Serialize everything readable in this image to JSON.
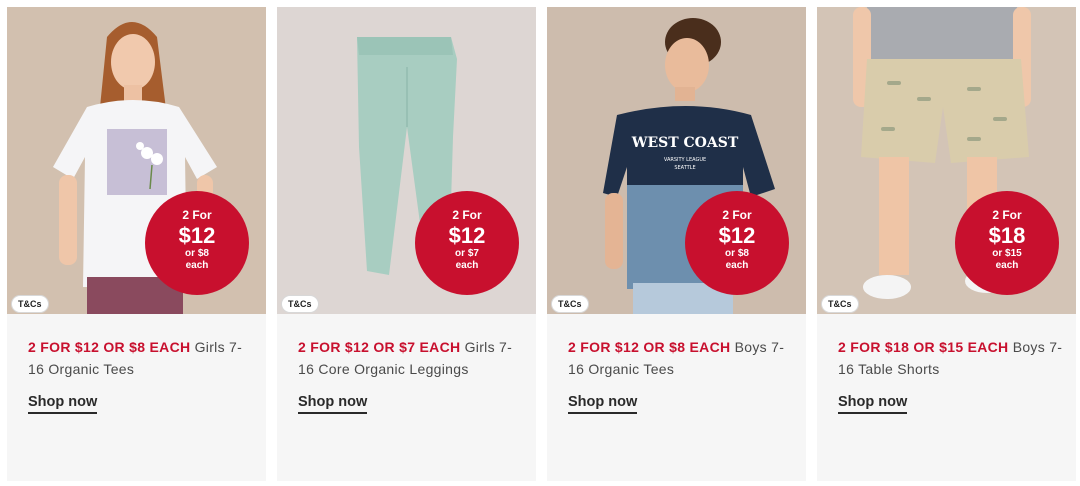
{
  "cards": [
    {
      "badge": {
        "line1": "2 For",
        "price": "$12",
        "line3": "or $8",
        "line4": "each"
      },
      "tcs": "T&Cs",
      "promo": "2 FOR $12 OR $8 EACH",
      "title": "Girls 7-16 Organic Tees",
      "cta": "Shop now",
      "image": "girl-in-flower-tee"
    },
    {
      "badge": {
        "line1": "2 For",
        "price": "$12",
        "line3": "or $7",
        "line4": "each"
      },
      "tcs": "T&Cs",
      "promo": "2 FOR $12 OR $7 EACH",
      "title": "Girls 7-16 Core Organic Leggings",
      "cta": "Shop now",
      "image": "mint-leggings"
    },
    {
      "badge": {
        "line1": "2 For",
        "price": "$12",
        "line3": "or $8",
        "line4": "each"
      },
      "tcs": "T&Cs",
      "promo": "2 FOR $12 OR $8 EACH",
      "title": "Boys 7-16 Organic Tees",
      "cta": "Shop now",
      "image": "boy-in-west-coast-tee",
      "tee_print": [
        "WEST COAST",
        "VARSITY LEAGUE",
        "SEATTLE"
      ]
    },
    {
      "badge": {
        "line1": "2 For",
        "price": "$18",
        "line3": "or $15",
        "line4": "each"
      },
      "tcs": "T&Cs",
      "promo": "2 FOR $18 OR $15 EACH",
      "title": "Boys 7-16 Table Shorts",
      "cta": "Shop now",
      "image": "boy-in-printed-shorts"
    }
  ],
  "colors": {
    "promo_red": "#c8102e",
    "card_bg": "#f6f6f6",
    "text": "#4a4a4a"
  }
}
